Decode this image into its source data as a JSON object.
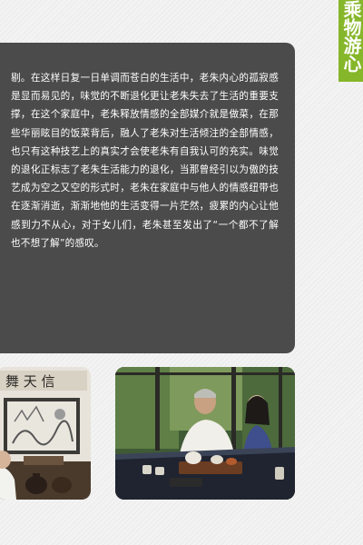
{
  "side_tab": {
    "text": "乘物游心",
    "color": "#86b62a"
  },
  "article": {
    "body": "剔。在这样日复一日单调而苍白的生活中，老朱内心的孤寂感是显而易见的，味觉的不断退化更让老朱失去了生活的重要支撑，在这个家庭中，老朱释放情感的全部媒介就是做菜，在那些华丽眩目的饭菜背后，融人了老朱对生活倾注的全部情感，也只有这种技艺上的真实才会使老朱有自我认可的充实。味觉的退化正标志了老朱生活能力的退化，当那曾经引以为傲的技艺成为空之又空的形式时，老朱在家庭中与他人的情感纽带也在逐渐消逝，渐渐地他的生活变得一片茫然，疲累的内心让他感到力不从心，对于女儿们，老朱甚至发出了“一个都不了解也不想了解”的感叹。"
  },
  "photos": {
    "left": {
      "scroll_text": "舞 天 信"
    },
    "right": {}
  }
}
